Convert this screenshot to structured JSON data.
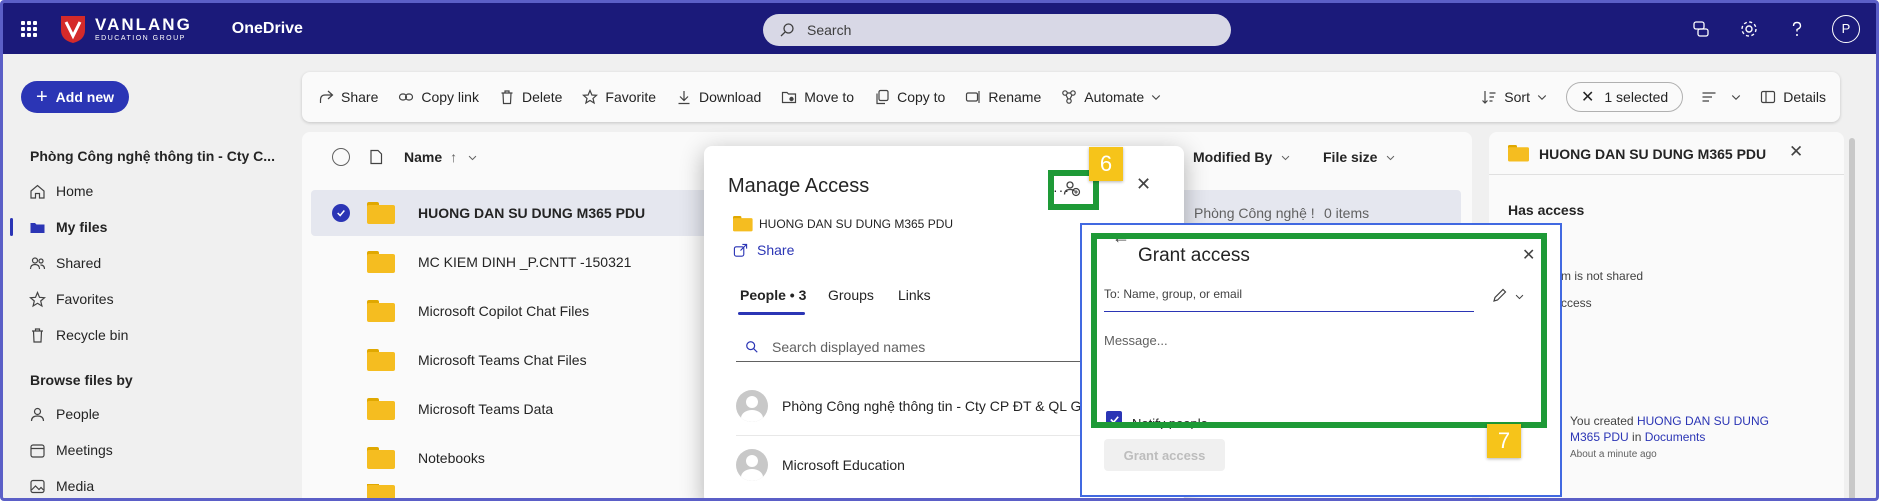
{
  "topbar": {
    "logo_main": "VANLANG",
    "logo_sub": "EDUCATION GROUP",
    "app_name": "OneDrive",
    "search_placeholder": "Search",
    "avatar_initial": "P"
  },
  "nav": {
    "add_new_label": "Add new",
    "site_title": "Phòng Công nghệ thông tin - Cty C...",
    "items": [
      {
        "label": "Home",
        "icon": "home-icon"
      },
      {
        "label": "My files",
        "icon": "folder-icon"
      },
      {
        "label": "Shared",
        "icon": "people-icon"
      },
      {
        "label": "Favorites",
        "icon": "star-icon"
      },
      {
        "label": "Recycle bin",
        "icon": "trash-icon"
      }
    ],
    "browse_title": "Browse files by",
    "browse_items": [
      {
        "label": "People",
        "icon": "person-icon"
      },
      {
        "label": "Meetings",
        "icon": "calendar-icon"
      },
      {
        "label": "Media",
        "icon": "image-icon"
      }
    ]
  },
  "commands": {
    "share": "Share",
    "copy_link": "Copy link",
    "delete": "Delete",
    "favorite": "Favorite",
    "download": "Download",
    "move_to": "Move to",
    "copy_to": "Copy to",
    "rename": "Rename",
    "automate": "Automate",
    "sort": "Sort",
    "selected": "1 selected",
    "details": "Details"
  },
  "list": {
    "col_name": "Name",
    "col_modified_by": "Modified By",
    "col_file_size": "File size",
    "rows": [
      {
        "name": "HUONG DAN SU DUNG M365 PDU",
        "modified_by": "Phòng Công nghệ !",
        "size": "0 items",
        "selected": true
      },
      {
        "name": "MC KIEM DINH _P.CNTT -150321"
      },
      {
        "name": "Microsoft Copilot Chat Files"
      },
      {
        "name": "Microsoft Teams Chat Files"
      },
      {
        "name": "Microsoft Teams Data"
      },
      {
        "name": "Notebooks"
      }
    ]
  },
  "details": {
    "folder_name": "HUONG DAN SU DUNG M365 PDU",
    "has_access": "Has access",
    "not_shared_fragment": "m is not shared",
    "access_fragment": "ccess",
    "activity_prefix": "You created ",
    "activity_item": "HUONG DAN SU DUNG M365 PDU",
    "activity_mid": " in ",
    "activity_location": "Documents",
    "activity_time": "About a minute ago"
  },
  "manage": {
    "title": "Manage Access",
    "folder_name": "HUONG DAN SU DUNG M365 PDU",
    "share_label": "Share",
    "tabs": [
      "People • 3",
      "Groups",
      "Links"
    ],
    "search_placeholder": "Search displayed names",
    "people": [
      "Phòng Công nghệ thông tin - Cty CP ĐT & QL GD",
      "Microsoft Education"
    ]
  },
  "grant": {
    "title": "Grant access",
    "to_placeholder": "To: Name, group, or email",
    "message_placeholder": "Message...",
    "notify_label": "Notify people",
    "button_label": "Grant access"
  },
  "callouts": {
    "six": "6",
    "seven": "7"
  },
  "colors": {
    "topbar": "#1b1a7a",
    "accent": "#2b35b5",
    "highlight_green": "#1e9a37",
    "highlight_blue": "#4169e1",
    "callout_yellow": "#f6c41a"
  }
}
